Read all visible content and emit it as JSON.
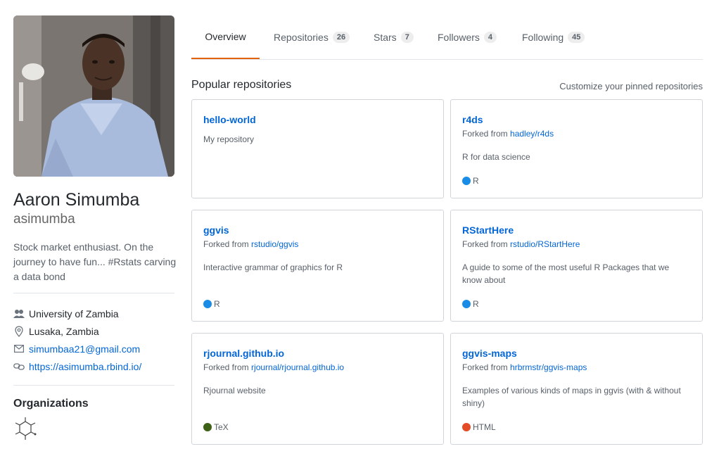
{
  "profile": {
    "full_name": "Aaron Simumba",
    "username": "asimumba",
    "bio": "Stock market enthusiast. On the journey to have fun... #Rstats carving a data bond",
    "organization": "University of Zambia",
    "location": "Lusaka, Zambia",
    "email": "simumbaa21@gmail.com",
    "website": "https://asimumba.rbind.io/",
    "orgs_title": "Organizations"
  },
  "tabs": [
    {
      "label": "Overview",
      "count": null,
      "active": true
    },
    {
      "label": "Repositories",
      "count": "26"
    },
    {
      "label": "Stars",
      "count": "7"
    },
    {
      "label": "Followers",
      "count": "4"
    },
    {
      "label": "Following",
      "count": "45"
    }
  ],
  "popular": {
    "title": "Popular repositories",
    "customize_label": "Customize your pinned repositories",
    "forked_prefix": "Forked from",
    "repos": [
      {
        "name": "hello-world",
        "fork_source": "",
        "description": "My repository",
        "language": "",
        "language_color": ""
      },
      {
        "name": "r4ds",
        "fork_source": "hadley/r4ds",
        "description": "R for data science",
        "language": "R",
        "language_color": "#198ce7"
      },
      {
        "name": "ggvis",
        "fork_source": "rstudio/ggvis",
        "description": "Interactive grammar of graphics for R",
        "language": "R",
        "language_color": "#198ce7"
      },
      {
        "name": "RStartHere",
        "fork_source": "rstudio/RStartHere",
        "description": "A guide to some of the most useful R Packages that we know about",
        "language": "R",
        "language_color": "#198ce7"
      },
      {
        "name": "rjournal.github.io",
        "fork_source": "rjournal/rjournal.github.io",
        "description": "Rjournal website",
        "language": "TeX",
        "language_color": "#3d6117"
      },
      {
        "name": "ggvis-maps",
        "fork_source": "hrbrmstr/ggvis-maps",
        "description": "Examples of various kinds of maps in ggvis (with & without shiny)",
        "language": "HTML",
        "language_color": "#e34c26"
      }
    ]
  },
  "colors": {
    "accent_tab": "#e36209",
    "link": "#0366d6"
  }
}
